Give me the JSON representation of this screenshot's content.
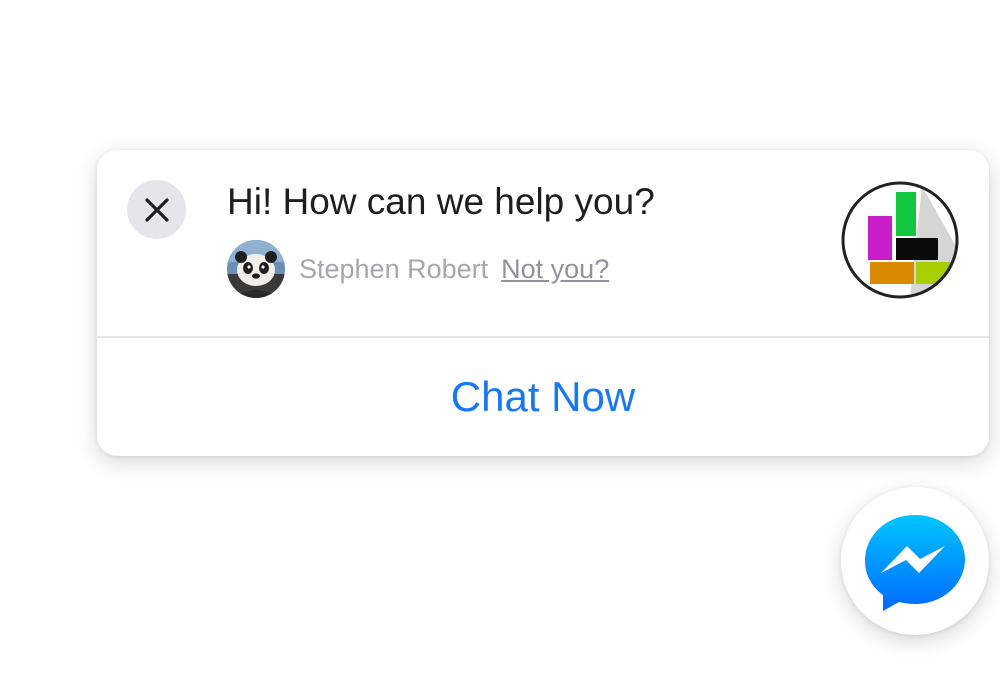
{
  "popup": {
    "greeting": "Hi! How can we help you?",
    "user_name": "Stephen Robert",
    "not_you_label": "Not you?",
    "chat_now_label": "Chat Now"
  },
  "icons": {
    "close": "close-icon",
    "avatar": "user-avatar",
    "page_logo": "page-logo",
    "messenger": "messenger-icon"
  },
  "colors": {
    "accent": "#1877f2",
    "messenger_gradient": [
      "#00c6ff",
      "#0068ff"
    ],
    "close_bg": "#e4e6eb",
    "muted_text": "#a5a7aa"
  }
}
